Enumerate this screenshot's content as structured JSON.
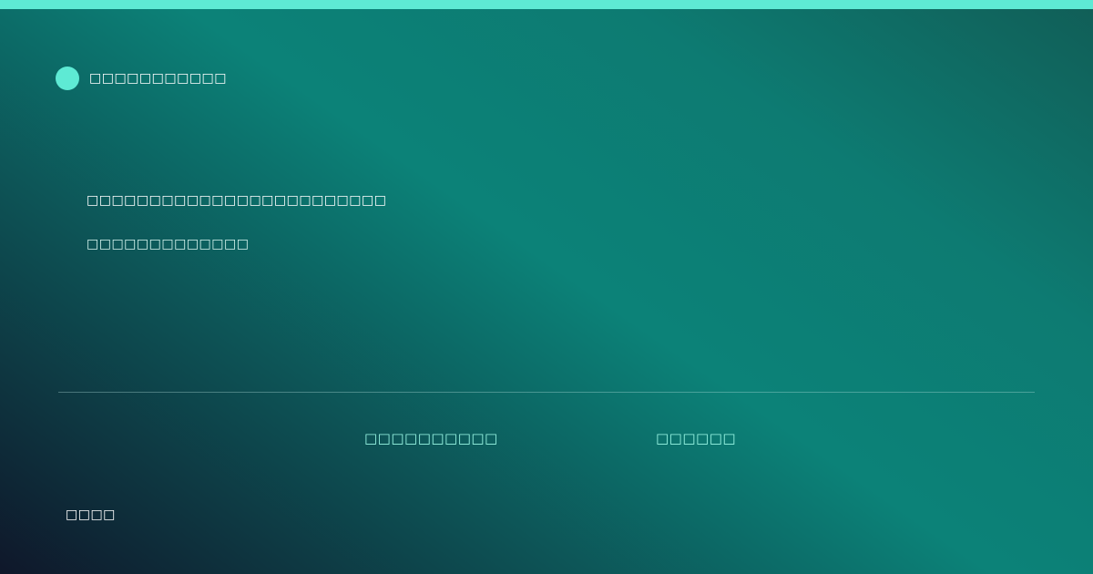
{
  "brand": {
    "name": "□□□□□□□□□□□"
  },
  "hero": {
    "headline": "□□□□□□□□□□□□□□□□□□□□□□□□",
    "subline": "□□□□□□□□□□□□□"
  },
  "meta": {
    "left": "□□□□□□□□□□",
    "right": "□□□□□□"
  },
  "footer": {
    "label": "□□□□"
  },
  "colors": {
    "accent": "#5eead4",
    "meta_text": "#99f6e4",
    "gradient_dark": "#0f172a",
    "gradient_teal": "#0c8278"
  }
}
